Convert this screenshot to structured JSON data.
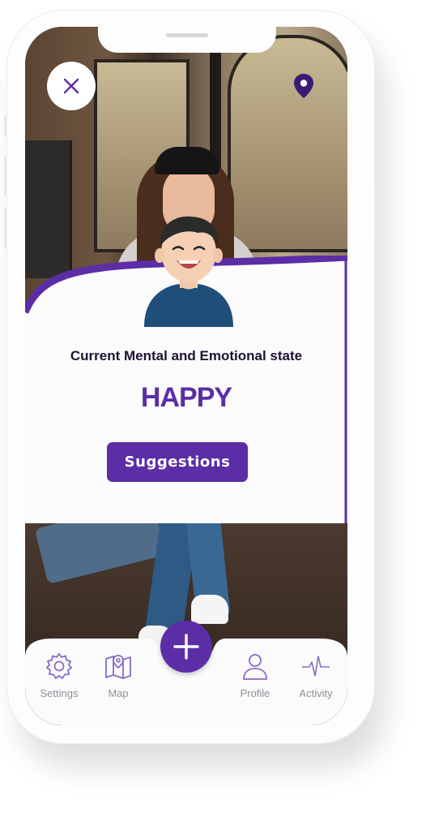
{
  "state": {
    "title": "Current Mental and Emotional state",
    "value": "HAPPY"
  },
  "actions": {
    "suggestions_label": "Suggestions"
  },
  "nav": {
    "items": [
      {
        "label": "Settings",
        "icon": "gear-icon"
      },
      {
        "label": "Map",
        "icon": "map-icon"
      },
      {
        "label": "Profile",
        "icon": "user-icon"
      },
      {
        "label": "Activity",
        "icon": "activity-icon"
      }
    ],
    "fab_icon": "plus-icon"
  },
  "colors": {
    "accent": "#5b2ea6",
    "title_text": "#1d1233",
    "nav_text": "#8f8f99"
  }
}
